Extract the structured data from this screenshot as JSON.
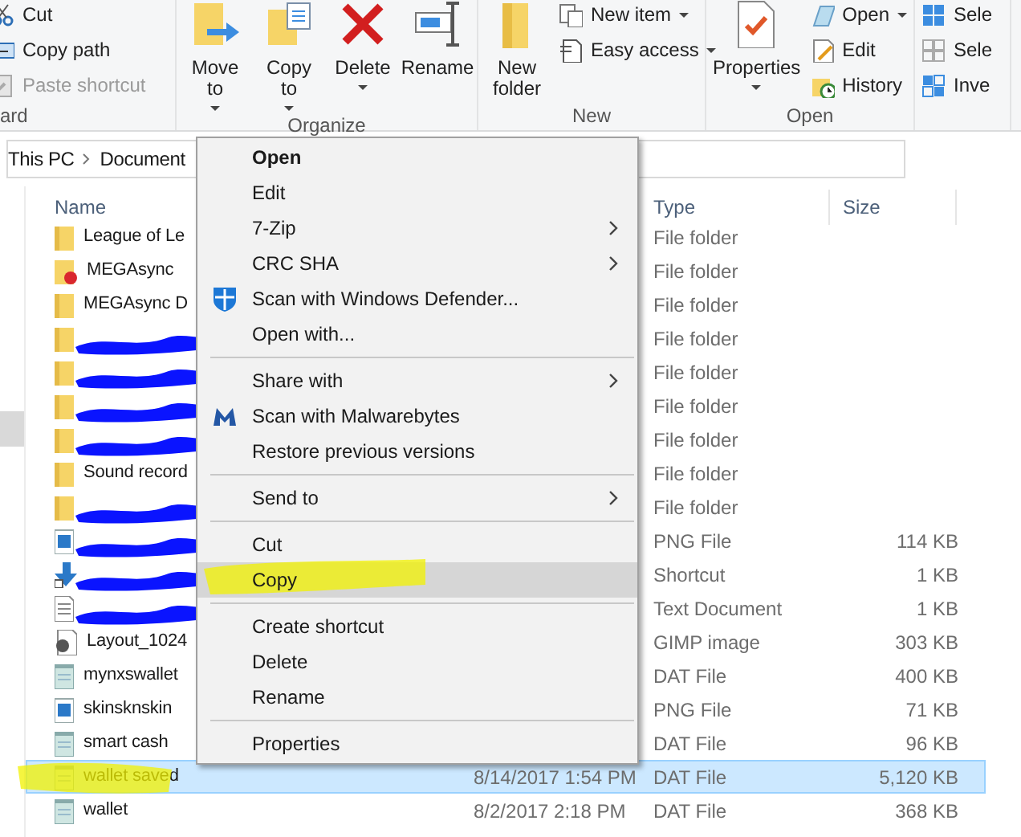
{
  "ribbon": {
    "groups": [
      {
        "label": "ard",
        "items": [
          {
            "kind": "small",
            "label": "Cut",
            "disabled": false
          },
          {
            "kind": "small",
            "label": "Copy path",
            "disabled": false
          },
          {
            "kind": "small",
            "label": "Paste shortcut",
            "disabled": true
          }
        ]
      },
      {
        "label": "Organize",
        "items": [
          {
            "kind": "large",
            "label": "Move to",
            "dropdown": true
          },
          {
            "kind": "large",
            "label": "Copy to",
            "dropdown": true
          },
          {
            "kind": "large",
            "label": "Delete",
            "dropdown": true
          },
          {
            "kind": "large",
            "label": "Rename",
            "dropdown": false
          }
        ]
      },
      {
        "label": "New",
        "items": [
          {
            "kind": "large",
            "label": "New folder",
            "dropdown": false
          },
          {
            "kind": "small",
            "label": "New item",
            "dropdown": true
          },
          {
            "kind": "small",
            "label": "Easy access",
            "dropdown": true
          }
        ]
      },
      {
        "label": "Open",
        "items": [
          {
            "kind": "large",
            "label": "Properties",
            "dropdown": true
          },
          {
            "kind": "small",
            "label": "Open",
            "dropdown": true
          },
          {
            "kind": "small",
            "label": "Edit",
            "dropdown": false
          },
          {
            "kind": "small",
            "label": "History",
            "dropdown": false
          }
        ]
      },
      {
        "items": [
          {
            "kind": "small",
            "label": "Sele"
          },
          {
            "kind": "small",
            "label": "Sele"
          },
          {
            "kind": "small",
            "label": "Inve"
          }
        ]
      }
    ]
  },
  "breadcrumb": [
    "This PC",
    "Document"
  ],
  "columns": [
    "Name",
    "Type",
    "Size"
  ],
  "files": [
    {
      "name": "League of Le",
      "type": "File folder",
      "kind": "folder",
      "redacted": false,
      "selected": false,
      "highlighted": false
    },
    {
      "name": "MEGAsync",
      "type": "File folder",
      "kind": "mega",
      "redacted": false,
      "selected": false,
      "highlighted": false
    },
    {
      "name": "MEGAsync D",
      "type": "File folder",
      "kind": "folder",
      "redacted": false,
      "selected": false,
      "highlighted": false
    },
    {
      "type": "File folder",
      "kind": "folder",
      "redacted": true,
      "selected": false,
      "highlighted": false
    },
    {
      "type": "File folder",
      "kind": "folder",
      "redacted": true,
      "selected": false,
      "highlighted": false
    },
    {
      "type": "File folder",
      "kind": "folder",
      "redacted": true,
      "selected": false,
      "highlighted": false
    },
    {
      "type": "File folder",
      "kind": "folder",
      "redacted": true,
      "selected": false,
      "highlighted": false
    },
    {
      "name": "Sound record",
      "type": "File folder",
      "kind": "folder",
      "redacted": false,
      "selected": false,
      "highlighted": false
    },
    {
      "type": "File folder",
      "kind": "folder",
      "redacted": true,
      "selected": false,
      "highlighted": false
    },
    {
      "type": "PNG File",
      "size": "114 KB",
      "kind": "image",
      "redacted": true,
      "selected": false,
      "highlighted": false
    },
    {
      "type": "Shortcut",
      "size": "1 KB",
      "kind": "shortcut",
      "redacted": true,
      "selected": false,
      "highlighted": false
    },
    {
      "type": "Text Document",
      "size": "1 KB",
      "kind": "text",
      "redacted": true,
      "selected": false,
      "highlighted": false
    },
    {
      "name": "Layout_1024",
      "type": "GIMP image",
      "size": "303 KB",
      "kind": "gimp",
      "redacted": false,
      "selected": false,
      "highlighted": false
    },
    {
      "name": "mynxswallet",
      "type": "DAT File",
      "size": "400 KB",
      "kind": "dat",
      "redacted": false,
      "selected": false,
      "highlighted": false
    },
    {
      "name": "skinsknskin",
      "type": "PNG File",
      "size": "71 KB",
      "kind": "image",
      "redacted": false,
      "selected": false,
      "highlighted": false
    },
    {
      "name": "smart cash",
      "type": "DAT File",
      "size": "96 KB",
      "kind": "dat",
      "redacted": false,
      "selected": false,
      "highlighted": false
    },
    {
      "name": "wallet saved",
      "date": "8/14/2017 1:54 PM",
      "type": "DAT File",
      "size": "5,120 KB",
      "kind": "dat",
      "redacted": false,
      "selected": true,
      "highlighted": true
    },
    {
      "name": "wallet",
      "date": "8/2/2017 2:18 PM",
      "type": "DAT File",
      "size": "368 KB",
      "kind": "dat",
      "redacted": false,
      "selected": false,
      "highlighted": false
    }
  ],
  "context_menu": [
    {
      "kind": "item",
      "label": "Open",
      "bold": true,
      "submenu": false,
      "selected": false,
      "highlighted": false
    },
    {
      "kind": "item",
      "label": "Edit",
      "bold": false,
      "submenu": false,
      "selected": false,
      "highlighted": false
    },
    {
      "kind": "item",
      "label": "7-Zip",
      "bold": false,
      "submenu": true,
      "selected": false,
      "highlighted": false
    },
    {
      "kind": "item",
      "label": "CRC SHA",
      "bold": false,
      "submenu": true,
      "selected": false,
      "highlighted": false
    },
    {
      "kind": "item",
      "label": "Scan with Windows Defender...",
      "bold": false,
      "submenu": false,
      "selected": false,
      "highlighted": false
    },
    {
      "kind": "item",
      "label": "Open with...",
      "bold": false,
      "submenu": false,
      "selected": false,
      "highlighted": false
    },
    {
      "kind": "separator"
    },
    {
      "kind": "item",
      "label": "Share with",
      "bold": false,
      "submenu": true,
      "selected": false,
      "highlighted": false
    },
    {
      "kind": "item",
      "label": "Scan with Malwarebytes",
      "bold": false,
      "submenu": false,
      "selected": false,
      "highlighted": false
    },
    {
      "kind": "item",
      "label": "Restore previous versions",
      "bold": false,
      "submenu": false,
      "selected": false,
      "highlighted": false
    },
    {
      "kind": "separator"
    },
    {
      "kind": "item",
      "label": "Send to",
      "bold": false,
      "submenu": true,
      "selected": false,
      "highlighted": false
    },
    {
      "kind": "separator"
    },
    {
      "kind": "item",
      "label": "Cut",
      "bold": false,
      "submenu": false,
      "selected": false,
      "highlighted": false
    },
    {
      "kind": "item",
      "label": "Copy",
      "bold": false,
      "submenu": false,
      "selected": true,
      "highlighted": true
    },
    {
      "kind": "separator"
    },
    {
      "kind": "item",
      "label": "Create shortcut",
      "bold": false,
      "submenu": false,
      "selected": false,
      "highlighted": false
    },
    {
      "kind": "item",
      "label": "Delete",
      "bold": false,
      "submenu": false,
      "selected": false,
      "highlighted": false
    },
    {
      "kind": "item",
      "label": "Rename",
      "bold": false,
      "submenu": false,
      "selected": false,
      "highlighted": false
    },
    {
      "kind": "separator"
    },
    {
      "kind": "item",
      "label": "Properties",
      "bold": false,
      "submenu": false,
      "selected": false,
      "highlighted": false
    }
  ]
}
